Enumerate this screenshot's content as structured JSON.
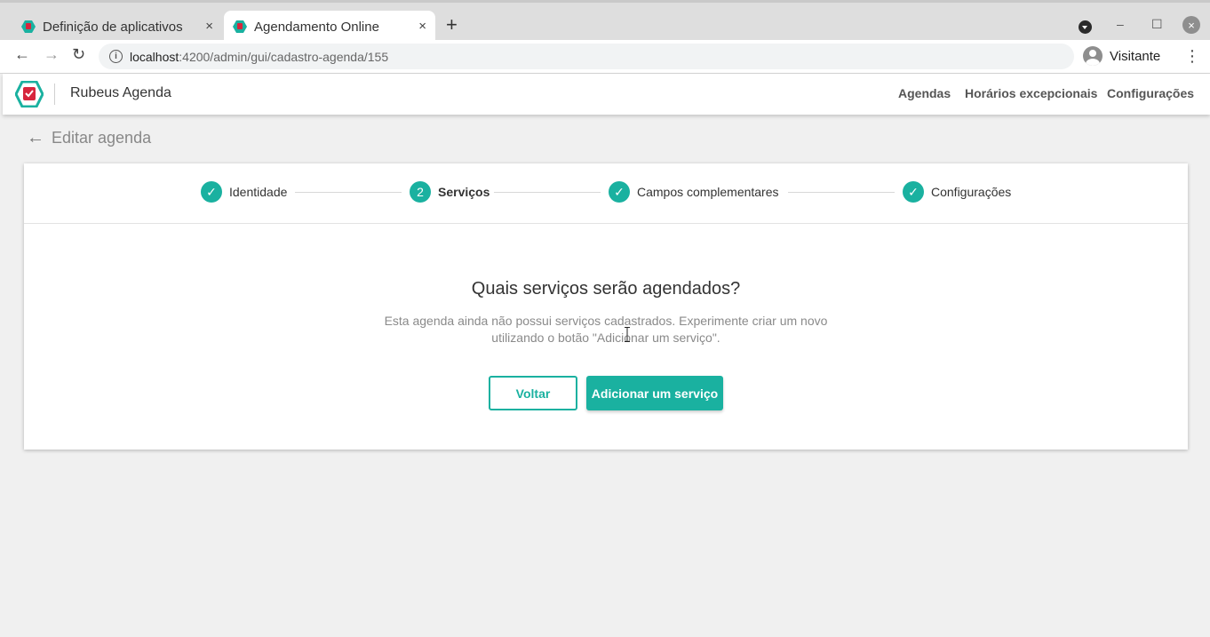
{
  "browser": {
    "tabs": [
      {
        "title": "Definição de aplicativos",
        "close": "×"
      },
      {
        "title": "Agendamento Online",
        "close": "×"
      }
    ],
    "new_tab": "+",
    "url_host": "localhost",
    "url_path": ":4200/admin/gui/cadastro-agenda/155",
    "profile_name": "Visitante",
    "window_controls": {
      "minimize": "–",
      "maximize": "☐",
      "close": "×"
    }
  },
  "app": {
    "title": "Rubeus Agenda",
    "nav": [
      "Agendas",
      "Horários excepcionais",
      "Configurações"
    ],
    "accent_color": "#1ab1a0",
    "logo_color": "#d7263d"
  },
  "page": {
    "back_label": "Editar agenda",
    "steps": [
      {
        "label": "Identidade",
        "icon": "check-icon",
        "marker": "✓"
      },
      {
        "label": "Serviços",
        "icon": "number",
        "marker": "2",
        "active": true
      },
      {
        "label": "Campos complementares",
        "icon": "check-icon",
        "marker": "✓"
      },
      {
        "label": "Configurações",
        "icon": "check-icon",
        "marker": "✓"
      }
    ],
    "heading": "Quais serviços serão agendados?",
    "description": "Esta agenda ainda não possui serviços cadastrados. Experimente criar um novo utilizando o botão \"Adicionar um serviço\".",
    "buttons": {
      "back": "Voltar",
      "add": "Adicionar um serviço"
    }
  }
}
